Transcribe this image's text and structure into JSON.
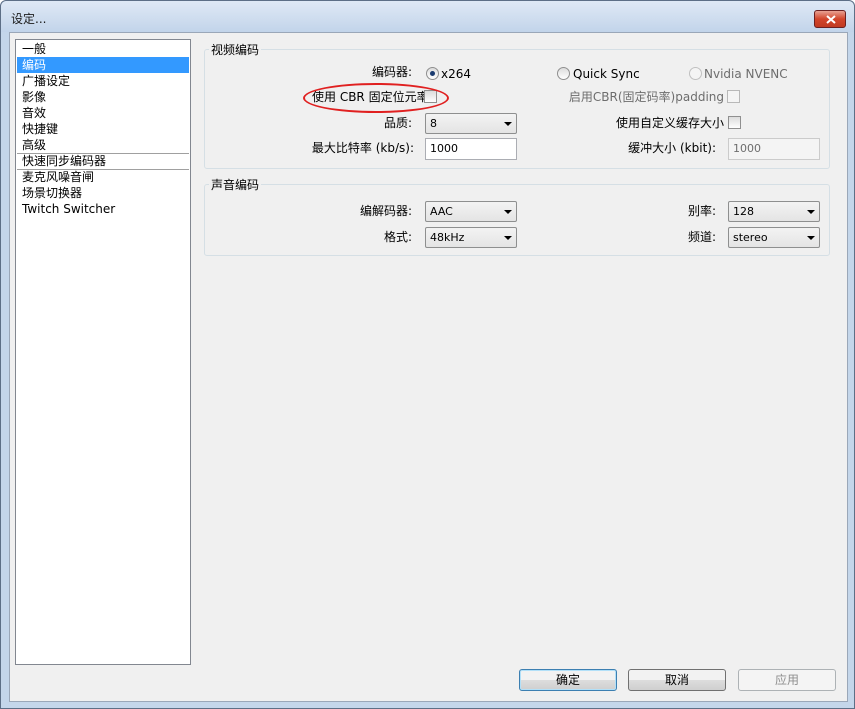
{
  "window": {
    "title": "设定..."
  },
  "nav": {
    "items": [
      {
        "label": "一般",
        "selected": false
      },
      {
        "label": "编码",
        "selected": true
      },
      {
        "label": "广播设定",
        "selected": false
      },
      {
        "label": "影像",
        "selected": false
      },
      {
        "label": "音效",
        "selected": false
      },
      {
        "label": "快捷键",
        "selected": false
      },
      {
        "label": "高级",
        "selected": false
      },
      {
        "label": "快速同步编码器",
        "selected": false
      },
      {
        "label": "麦克风噪音闸",
        "selected": false
      },
      {
        "label": "场景切换器",
        "selected": false
      },
      {
        "label": "Twitch Switcher",
        "selected": false
      }
    ]
  },
  "video": {
    "group_title": "视频编码",
    "encoder_label": "编码器:",
    "encoders": [
      {
        "label": "x264",
        "checked": true,
        "enabled": true
      },
      {
        "label": "Quick Sync",
        "checked": false,
        "enabled": true
      },
      {
        "label": "Nvidia NVENC",
        "checked": false,
        "enabled": false
      }
    ],
    "cbr_label": "使用 CBR 固定位元率",
    "cbr_checked": false,
    "cbr_padding_label": "启用CBR(固定码率)padding",
    "cbr_padding_checked": false,
    "quality_label": "品质:",
    "quality_value": "8",
    "custom_buffer_label": "使用自定义缓存大小",
    "custom_buffer_checked": false,
    "max_bitrate_label": "最大比特率 (kb/s):",
    "max_bitrate_value": "1000",
    "buffer_size_label": "缓冲大小 (kbit):",
    "buffer_size_value": "1000"
  },
  "audio": {
    "group_title": "声音编码",
    "codec_label": "编解码器:",
    "codec_value": "AAC",
    "bitrate_label": "别率:",
    "bitrate_value": "128",
    "format_label": "格式:",
    "format_value": "48kHz",
    "channel_label": "频道:",
    "channel_value": "stereo"
  },
  "buttons": {
    "ok": "确定",
    "cancel": "取消",
    "apply": "应用"
  },
  "colors": {
    "selection": "#3399ff",
    "highlight_ellipse": "#e02020",
    "dialog_bg": "#f0f0f0"
  }
}
